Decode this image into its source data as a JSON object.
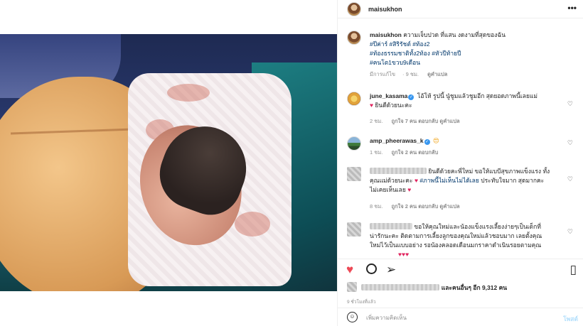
{
  "post": {
    "username": "maisukhon",
    "more_icon": "more-horizontal-icon"
  },
  "caption": {
    "username": "maisukhon",
    "text": "ความเจ็บปวด ที่แสน งดงามที่สุดของฉัน",
    "tags_line1": "#ปีค่าร์ #สิริรัชต์ #ท้อง2",
    "tags_line2": "#ท้องธรรมชาติทั้ง2ท้อง #หัวปีท้ายปี",
    "tags_line3": "#คนโต1ขวบ9เดือน",
    "meta_edited": "มีการแก้ไข",
    "meta_time": "9 ชม.",
    "meta_translate": "ดูคำแปล"
  },
  "comments": [
    {
      "username": "june_kasama",
      "verified": true,
      "text": "โอ้โห้ รูปนี้ นู๋ชูมแล้วชูมอีก สุดยอดภาพนี้เลยแม่",
      "text2": "ยินดีด้วยนะคะ",
      "time": "2 ชม.",
      "likes": "ถูกใจ 7 คน",
      "reply": "ตอบกลับ",
      "translate": "ดูคำแปล"
    },
    {
      "username": "amp_pheerawas_k",
      "verified": true,
      "text": "",
      "time": "1 ชม.",
      "likes": "ถูกใจ 2 คน",
      "reply": "ตอบกลับ"
    },
    {
      "username": "",
      "text": "ยินดีด้วยคะพี่ใหม่ ขอให้แบบีสุขภาพแข็งแรง ทั้ง",
      "text2": "คุณแม่ด้วยนะคะ",
      "tag": "#ภาพนี้ไม่เห็นไม่ได้เลย",
      "text3": "ประทับใจมาก สุดมากคะ",
      "text4": "ไม่เคยเห็นเลย",
      "time": "8 ชม.",
      "likes": "ถูกใจ 2 คน",
      "reply": "ตอบกลับ",
      "translate": "ดูคำแปล"
    },
    {
      "username": "",
      "text": "ขอให้คุณใหม่และน้องแข็งแรงเลี้ยงง่ายๆเป็นเด็กที่",
      "text2": "น่ารักนะคะ ติดตามการเลี้ยงลูกของคุณใหม่แล้วชอบมาก เลยตั้งคุณ",
      "text3": "ใหม่ไว้เป็นแบบอย่าง รอน้องคลอดเดือนมกราคาดำเนินรอยตามคุณ"
    }
  ],
  "likes_summary": {
    "text": "และคนอื่นๆ อีก 9,312 คน"
  },
  "timestamp": "9 ชั่วโมงที่แล้ว",
  "add_comment": {
    "placeholder": "เพิ่มความคิดเห็น",
    "post_label": "โพสต์"
  },
  "colors": {
    "link": "#00376b",
    "verified": "#3897f0",
    "like_red": "#ed4956",
    "post_disabled": "#b2dffc"
  }
}
